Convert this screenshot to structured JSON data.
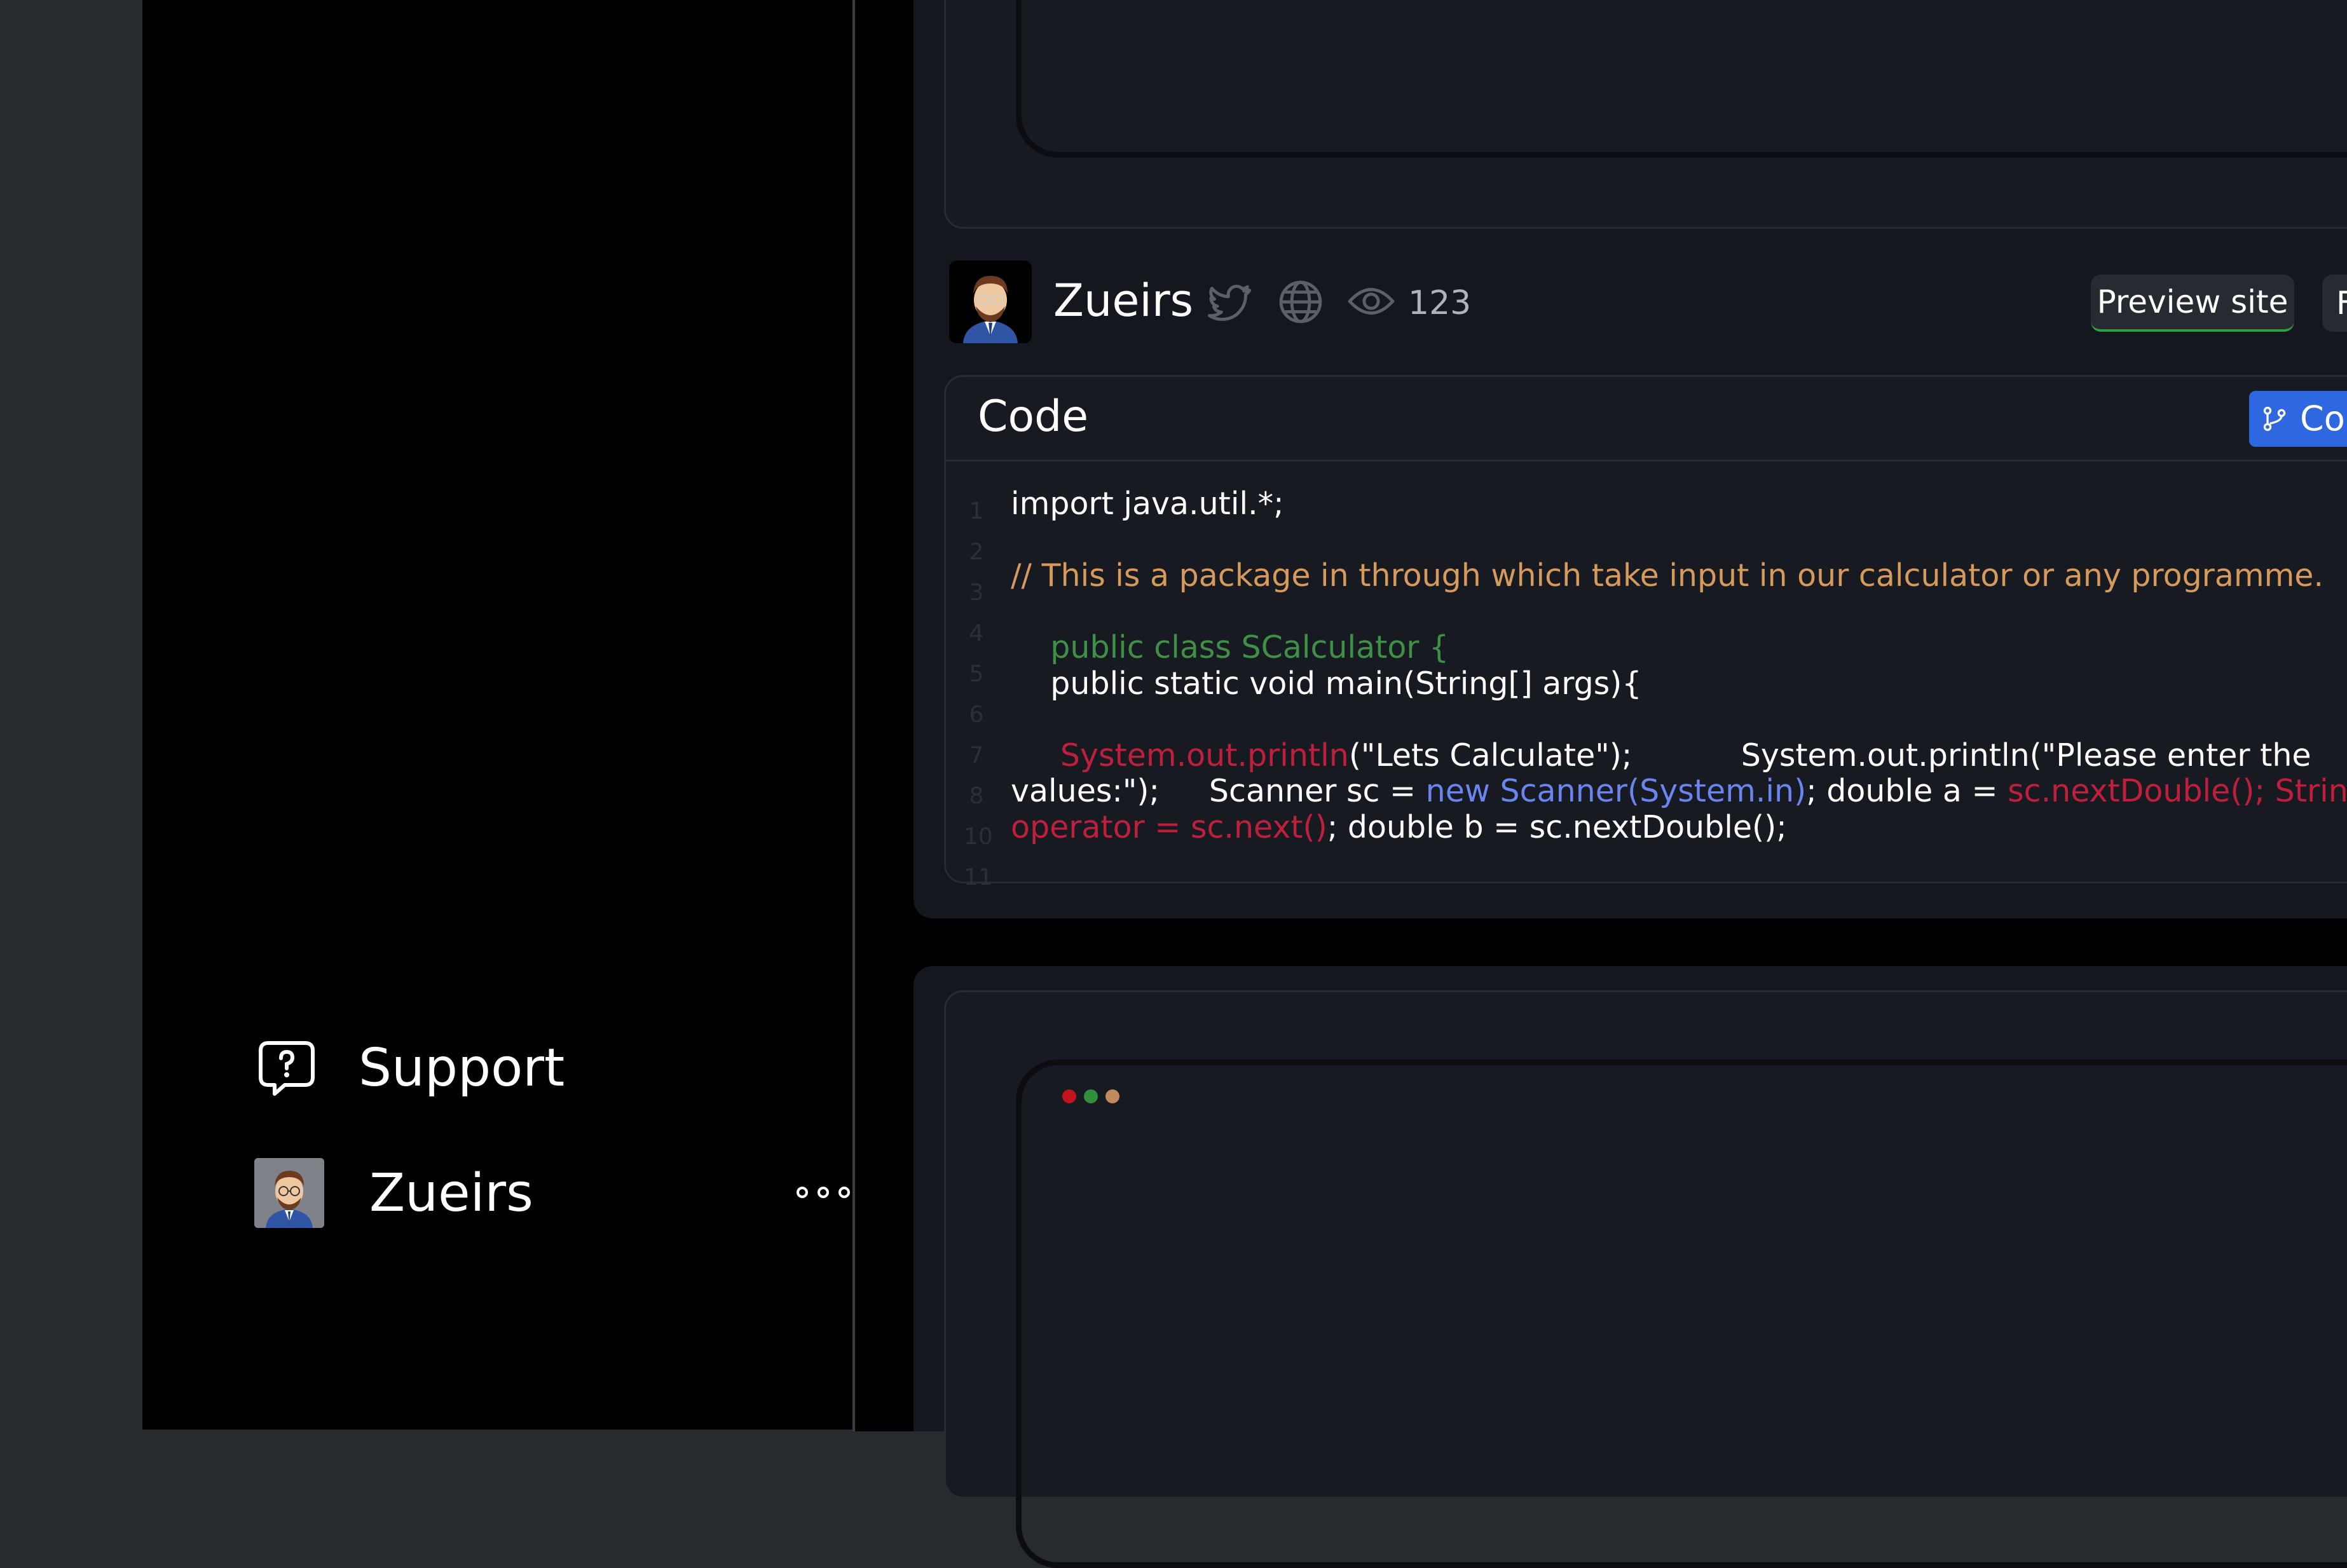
{
  "sidebar": {
    "support_label": "Support",
    "user_name": "Zueirs",
    "icons": {
      "support": "help-chat-bubble-icon",
      "more": "ellipsis-icon"
    }
  },
  "project": {
    "author_name": "Zueirs",
    "view_count": "123",
    "preview_button": "Preview site",
    "next_button_partial": "F",
    "icons": [
      "twitter-icon",
      "globe-icon",
      "eye-icon"
    ]
  },
  "code_panel": {
    "title": "Code",
    "copy_label": "Copy",
    "line_numbers": [
      "1",
      "2",
      "3",
      "4",
      "5",
      "6",
      "7",
      "8",
      "10",
      "11"
    ],
    "lines": {
      "l1": "import java.util.*;",
      "l3": "// This is a package in through which take input in our calculator or any programme.",
      "l5a": "    public class SCalculator {",
      "l5b": "    public static void main(String[] args){",
      "l7_red": "     System.out.println",
      "l7_rest": "(\"Lets Calculate\");           System.out.println(\"Please enter the",
      "l8_a": "values:\");     Scanner sc = ",
      "l8_blue": "new Scanner(System.in)",
      "l8_b": "; double a = ",
      "l8_red": "sc.nextDouble(); String",
      "l9_red": "operator = sc.next()",
      "l9_rest": "; double b = sc.nextDouble();"
    }
  },
  "colors": {
    "page_bg": "#272a2f",
    "sidebar_bg": "#000000",
    "card_bg": "#14171d",
    "accent_blue": "#2f67e0",
    "accent_green": "#2ea043",
    "comment": "#d59a5c",
    "keyword_green": "#3f8f46",
    "string_red": "#bf1f3d",
    "link_blue": "#6a85f0",
    "traffic_lights": [
      "#c0141e",
      "#2f8f3a",
      "#c08a5a"
    ]
  }
}
